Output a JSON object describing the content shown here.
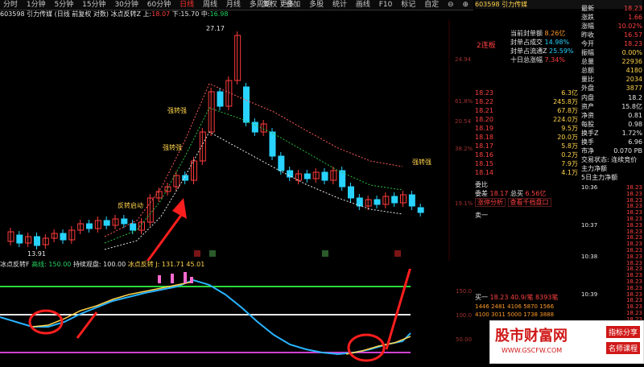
{
  "toolbar": {
    "periods": [
      "分时",
      "1分钟",
      "5分钟",
      "15分钟",
      "30分钟",
      "60分钟",
      "日线",
      "周线",
      "月线",
      "多周期",
      "更多"
    ],
    "active_period": "日线",
    "right_items": [
      "复权",
      "叠加",
      "多股",
      "统计",
      "画线",
      "F10",
      "标记",
      "自定",
      "⊖",
      "⊕"
    ]
  },
  "header": {
    "code": "603598",
    "name": "引力传媒",
    "mode": "(日线 前复权 对数)",
    "indicator": "冰点反转Z",
    "high_label": "上:",
    "high": "18.07",
    "low_label": "下:",
    "low": "15.70",
    "mid_label": "中:",
    "mid": "16.98"
  },
  "main_chart": {
    "peak_label": "27.17",
    "low_label": "13.91",
    "signals": [
      "强转强",
      "强转强",
      "反转启动",
      "强转强",
      "反转启动"
    ],
    "right_axis": [
      "24.94",
      "61.8%",
      "20.54",
      "38.2%",
      "19.1%"
    ],
    "tags": [
      "短",
      "短",
      "B",
      "B"
    ]
  },
  "sub_chart": {
    "indicator": "冰点反转F",
    "high_label": "高线: 150.00",
    "mid_label": "持续观盘: 100.00",
    "extra": "冰点反转  J: 131.71  45.01",
    "axis": [
      "150.0",
      "100.0",
      "50.00"
    ]
  },
  "info_panel": {
    "code": "603598",
    "name": "引力传媒",
    "limit_tag": "2连板",
    "limit_stats": [
      {
        "label": "当前封单额",
        "value": "8.26亿"
      },
      {
        "label": "封单占成交",
        "value": "14.98%"
      },
      {
        "label": "封单占流通Z",
        "value": "25.59%"
      },
      {
        "label": "十日总涨幅",
        "value": "7.34%"
      }
    ],
    "quote": [
      {
        "label": "最新",
        "value": "18.23"
      },
      {
        "label": "涨跌",
        "value": "1.66"
      },
      {
        "label": "涨幅",
        "value": "10.02%"
      },
      {
        "label": "昨收",
        "value": "16.57"
      },
      {
        "label": "今开",
        "value": "18.23"
      },
      {
        "label": "振幅",
        "value": "0.00%"
      },
      {
        "label": "总量",
        "value": "22936"
      },
      {
        "label": "总额",
        "value": "4180"
      },
      {
        "label": "量比",
        "value": "2034"
      },
      {
        "label": "外盘",
        "value": "3877"
      }
    ],
    "bids": [
      {
        "price": "18.23",
        "vol": "6.3亿"
      },
      {
        "price": "18.22",
        "vol": "245.8万"
      },
      {
        "price": "18.21",
        "vol": "67.8万"
      },
      {
        "price": "18.20",
        "vol": "224.0万"
      },
      {
        "price": "18.19",
        "vol": "9.5万"
      },
      {
        "price": "18.18",
        "vol": "20.0万"
      },
      {
        "price": "18.17",
        "vol": "5.8万"
      },
      {
        "price": "18.16",
        "vol": "0.2万"
      },
      {
        "price": "18.15",
        "vol": "7.9万"
      },
      {
        "price": "18.14",
        "vol": "4.1万"
      }
    ],
    "finance": [
      {
        "label": "内盘",
        "value": "18.2"
      },
      {
        "label": "资产",
        "value": "15.8亿"
      },
      {
        "label": "净资",
        "value": "0.81"
      },
      {
        "label": "每股",
        "value": "0.98"
      },
      {
        "label": "换手Z",
        "value": "1.72%"
      },
      {
        "label": "换手",
        "value": "6.96"
      },
      {
        "label": "市净",
        "value": "0.070 PB"
      }
    ],
    "status": "交易状态: 连续竞价",
    "main_force1": "主力净额",
    "main_force2": "5日主力净额",
    "order_summary": [
      {
        "label": "委比",
        "value": "18.23"
      },
      {
        "label": "委差",
        "value": "18.17"
      },
      {
        "label": "总买",
        "value": "6.56亿"
      }
    ],
    "links": [
      "涨停分析",
      "查看千档盘口"
    ],
    "sell_label": "卖一",
    "buy_label": "买一",
    "buy_row": "18.23  40.9/笔  8393笔",
    "queue": [
      [
        "1446",
        "2481",
        "4106",
        "5870",
        "1566"
      ],
      [
        "4100",
        "3011",
        "5000",
        "1738",
        "3888"
      ]
    ],
    "times": [
      "10:36",
      "10:37",
      "10:38",
      "10:39"
    ],
    "prices": [
      "18.23",
      "18.23",
      "18.23",
      "18.23",
      "18.23",
      "18.23",
      "18.23",
      "18.23",
      "18.23",
      "18.23",
      "18.23",
      "18.23",
      "18.23",
      "18.23",
      "18.23",
      "18.23",
      "18.23",
      "18.23",
      "18.23",
      "18.23",
      "18.23",
      "18.23",
      "18.23"
    ]
  },
  "watermark": {
    "brand": "股市财富网",
    "url": "WWW.GSCFW.COM",
    "tag1": "指标分享",
    "tag2": "名师课程"
  },
  "chart_data": {
    "type": "candlestick",
    "title": "",
    "series": [
      {
        "o": 14.2,
        "c": 14.8
      },
      {
        "o": 14.6,
        "c": 14.1
      },
      {
        "o": 14.1,
        "c": 14.5
      },
      {
        "o": 14.5,
        "c": 13.95
      },
      {
        "o": 14.0,
        "c": 14.4
      },
      {
        "o": 14.4,
        "c": 14.7
      },
      {
        "o": 14.7,
        "c": 14.3
      },
      {
        "o": 14.3,
        "c": 14.9
      },
      {
        "o": 14.9,
        "c": 15.3
      },
      {
        "o": 15.3,
        "c": 15.0
      },
      {
        "o": 15.0,
        "c": 15.5
      },
      {
        "o": 15.5,
        "c": 15.2
      },
      {
        "o": 15.2,
        "c": 15.6
      },
      {
        "o": 15.6,
        "c": 15.3
      },
      {
        "o": 15.3,
        "c": 14.9
      },
      {
        "o": 14.9,
        "c": 15.4
      },
      {
        "o": 15.4,
        "c": 16.9
      },
      {
        "o": 16.9,
        "c": 17.3
      },
      {
        "o": 17.3,
        "c": 17.6
      },
      {
        "o": 17.6,
        "c": 18.3
      },
      {
        "o": 18.3,
        "c": 18.0
      },
      {
        "o": 18.0,
        "c": 19.2
      },
      {
        "o": 19.2,
        "c": 21.0
      },
      {
        "o": 21.0,
        "c": 23.5
      },
      {
        "o": 23.5,
        "c": 22.6
      },
      {
        "o": 22.6,
        "c": 24.2
      },
      {
        "o": 24.2,
        "c": 27.0
      },
      {
        "o": 23.8,
        "c": 21.6
      },
      {
        "o": 21.6,
        "c": 21.0
      },
      {
        "o": 21.0,
        "c": 21.5
      },
      {
        "o": 21.0,
        "c": 19.5
      },
      {
        "o": 19.5,
        "c": 18.6
      },
      {
        "o": 18.6,
        "c": 18.2
      },
      {
        "o": 18.0,
        "c": 18.4
      },
      {
        "o": 18.4,
        "c": 18.1
      },
      {
        "o": 18.1,
        "c": 18.5
      },
      {
        "o": 18.5,
        "c": 18.0
      },
      {
        "o": 18.0,
        "c": 18.6
      },
      {
        "o": 18.6,
        "c": 17.6
      },
      {
        "o": 17.6,
        "c": 16.9
      },
      {
        "o": 16.9,
        "c": 16.4
      },
      {
        "o": 16.4,
        "c": 16.8
      },
      {
        "o": 16.8,
        "c": 16.5
      },
      {
        "o": 16.5,
        "c": 17.0
      },
      {
        "o": 17.0,
        "c": 16.6
      },
      {
        "o": 16.6,
        "c": 17.1
      },
      {
        "o": 17.1,
        "c": 16.4
      },
      {
        "o": 16.3,
        "c": 16.0
      }
    ]
  }
}
